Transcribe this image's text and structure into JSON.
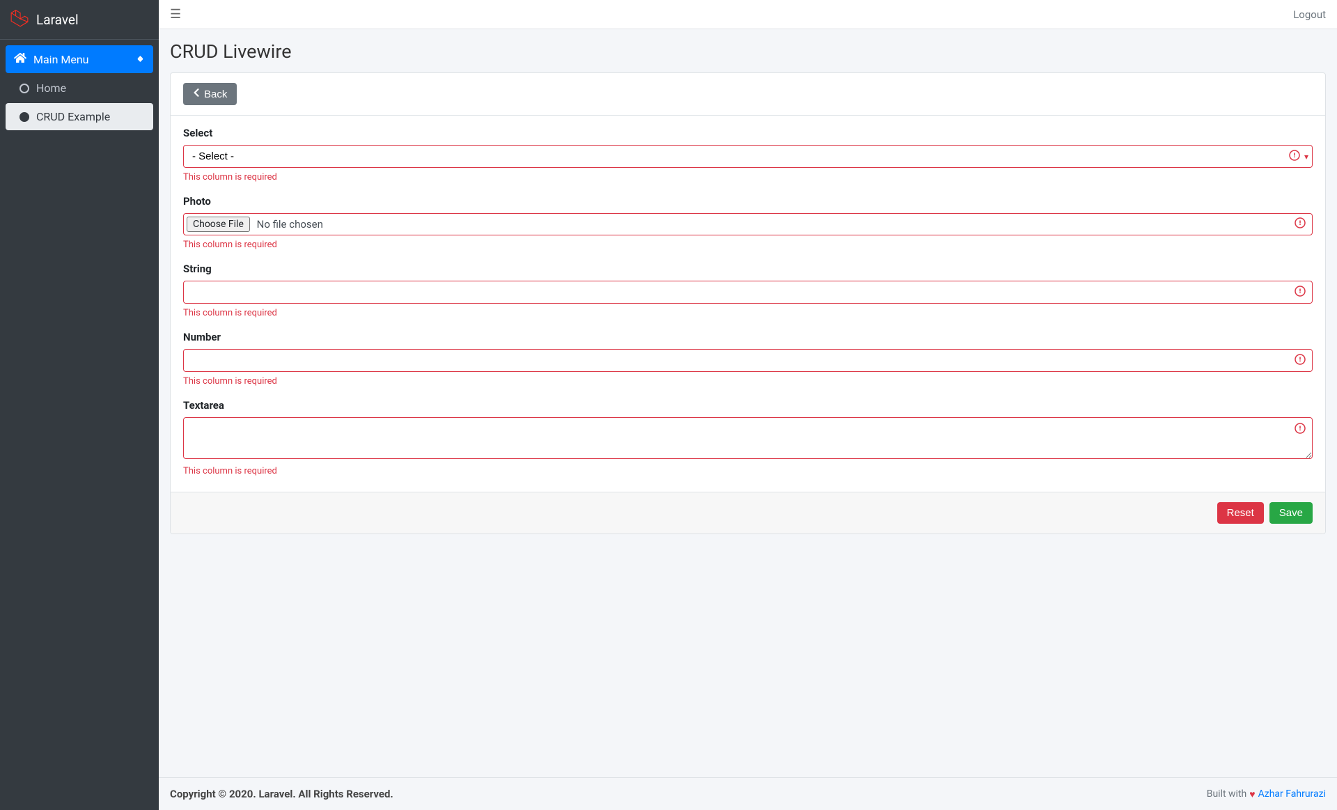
{
  "brand": {
    "name": "Laravel"
  },
  "sidebar": {
    "group": {
      "label": "Main Menu"
    },
    "items": [
      {
        "label": "Home",
        "active": false
      },
      {
        "label": "CRUD Example",
        "active": true
      }
    ]
  },
  "topbar": {
    "logout": "Logout"
  },
  "page": {
    "title": "CRUD Livewire"
  },
  "toolbar": {
    "back": "Back"
  },
  "error_text": "This column is required",
  "form": {
    "select": {
      "label": "Select",
      "placeholder": "- Select -"
    },
    "photo": {
      "label": "Photo",
      "choose": "Choose File",
      "nofile": "No file chosen"
    },
    "string": {
      "label": "String"
    },
    "number": {
      "label": "Number"
    },
    "textarea": {
      "label": "Textarea"
    }
  },
  "buttons": {
    "reset": "Reset",
    "save": "Save"
  },
  "footer": {
    "left": "Copyright © 2020. Laravel. All Rights Reserved.",
    "right_prefix": "Built with",
    "right_link": "Azhar Fahrurazi"
  }
}
